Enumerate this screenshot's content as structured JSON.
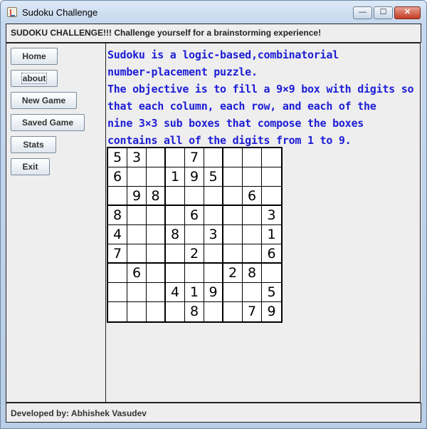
{
  "window": {
    "title": "Sudoku Challenge",
    "minimize_glyph": "—",
    "maximize_glyph": "☐",
    "close_glyph": "✕"
  },
  "header": {
    "text": "SUDOKU CHALLENGE!!! Challenge yourself for a brainstorming experience!"
  },
  "sidebar": {
    "buttons": [
      {
        "label": "Home"
      },
      {
        "label": "about"
      },
      {
        "label": "New Game"
      },
      {
        "label": "Saved Game"
      },
      {
        "label": "Stats"
      },
      {
        "label": "Exit"
      }
    ]
  },
  "description": {
    "lines": [
      "Sudoku is a logic-based,combinatorial",
      "number-placement puzzle.",
      "The objective is to fill a 9×9 box with digits so",
      "that each column, each row, and each of the",
      "nine 3×3 sub boxes that compose the boxes",
      "contains all of the digits from 1 to 9."
    ],
    "color": "#1c1cd6"
  },
  "sudoku": {
    "grid": [
      [
        "5",
        "3",
        "",
        "",
        "7",
        "",
        "",
        "",
        ""
      ],
      [
        "6",
        "",
        "",
        "1",
        "9",
        "5",
        "",
        "",
        ""
      ],
      [
        "",
        "9",
        "8",
        "",
        "",
        "",
        "",
        "6",
        ""
      ],
      [
        "8",
        "",
        "",
        "",
        "6",
        "",
        "",
        "",
        "3"
      ],
      [
        "4",
        "",
        "",
        "8",
        "",
        "3",
        "",
        "",
        "1"
      ],
      [
        "7",
        "",
        "",
        "",
        "2",
        "",
        "",
        "",
        "6"
      ],
      [
        "",
        "6",
        "",
        "",
        "",
        "",
        "2",
        "8",
        ""
      ],
      [
        "",
        "",
        "",
        "4",
        "1",
        "9",
        "",
        "",
        "5"
      ],
      [
        "",
        "",
        "",
        "",
        "8",
        "",
        "",
        "7",
        "9"
      ]
    ]
  },
  "footer": {
    "text": "Developed by: Abhishek Vasudev"
  }
}
